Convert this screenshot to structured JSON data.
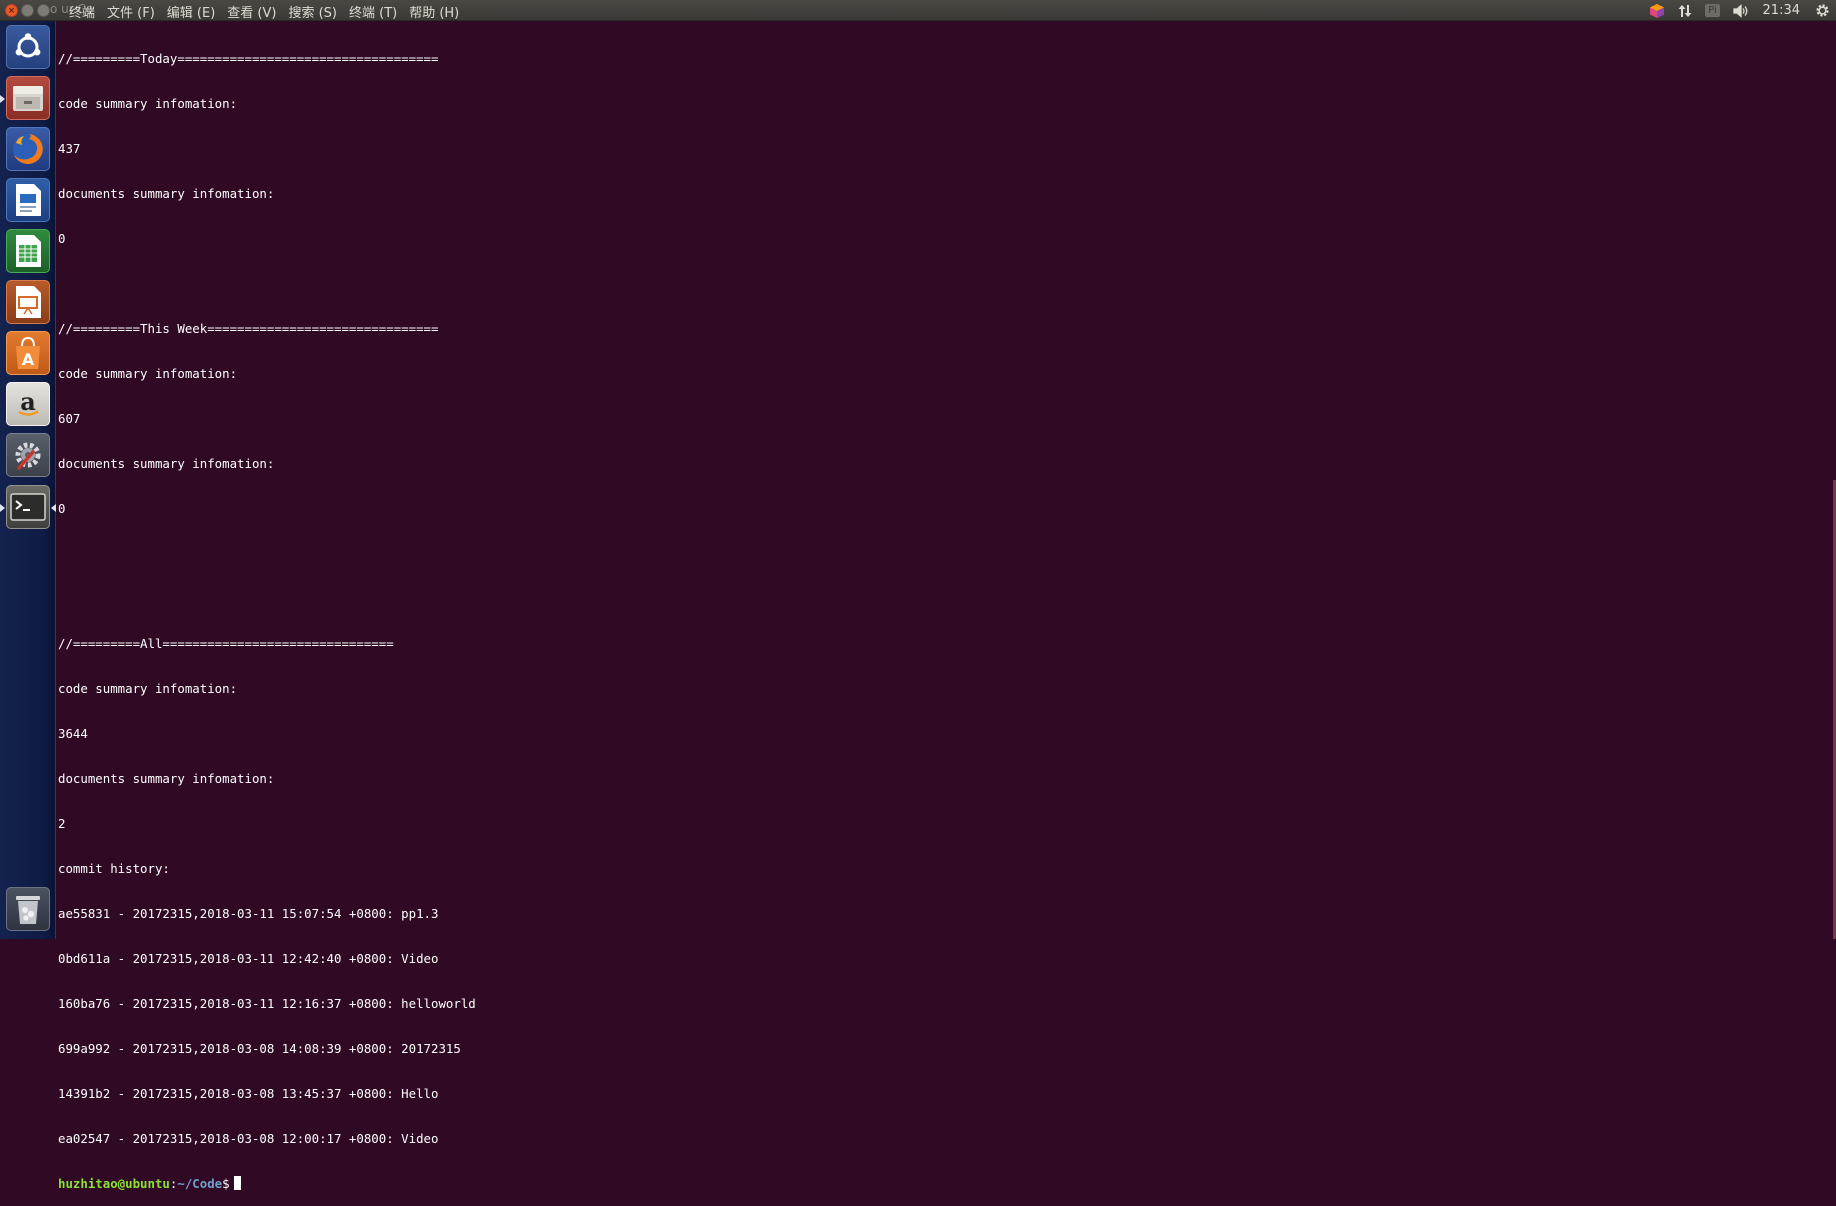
{
  "topbar": {
    "title_fragment": "o  ur  Co",
    "menu": [
      "终端",
      "文件 (F)",
      "编辑 (E)",
      "查看 (V)",
      "搜索 (S)",
      "终端 (T)",
      "帮助 (H)"
    ],
    "indicators": {
      "app_icon": "cube-icon",
      "network_icon": "network-updown-icon",
      "keyboard_label": "Pi",
      "volume_icon": "volume-icon",
      "clock": "21:34",
      "settings_icon": "gear-icon"
    }
  },
  "launcher": {
    "items": [
      {
        "name": "ubuntu-dash",
        "icon": "ubuntu-logo-icon"
      },
      {
        "name": "files",
        "icon": "file-cabinet-icon"
      },
      {
        "name": "firefox",
        "icon": "firefox-icon"
      },
      {
        "name": "writer",
        "icon": "document-icon"
      },
      {
        "name": "calc",
        "icon": "spreadsheet-icon"
      },
      {
        "name": "impress",
        "icon": "presentation-icon"
      },
      {
        "name": "software-center",
        "icon": "shopping-bag-icon"
      },
      {
        "name": "amazon",
        "icon": "amazon-icon"
      },
      {
        "name": "system-settings",
        "icon": "wrench-gear-icon"
      },
      {
        "name": "terminal",
        "icon": "terminal-icon"
      },
      {
        "name": "trash",
        "icon": "trash-icon"
      }
    ]
  },
  "terminal": {
    "lines": [
      "//=========Today===================================",
      "code summary infomation:",
      "437",
      "documents summary infomation:",
      "0",
      "",
      "//=========This Week===============================",
      "code summary infomation:",
      "607",
      "documents summary infomation:",
      "0",
      "",
      "",
      "//=========All===============================",
      "code summary infomation:",
      "3644",
      "documents summary infomation:",
      "2",
      "commit history:",
      "ae55831 - 20172315,2018-03-11 15:07:54 +0800: pp1.3",
      "0bd611a - 20172315,2018-03-11 12:42:40 +0800: Video",
      "160ba76 - 20172315,2018-03-11 12:16:37 +0800: helloworld",
      "699a992 - 20172315,2018-03-08 14:08:39 +0800: 20172315",
      "14391b2 - 20172315,2018-03-08 13:45:37 +0800: Hello",
      "ea02547 - 20172315,2018-03-08 12:00:17 +0800: Video"
    ],
    "prompt": {
      "user_host": "huzhitao@ubuntu",
      "separator": ":",
      "path": "~/Code",
      "symbol": "$"
    }
  }
}
